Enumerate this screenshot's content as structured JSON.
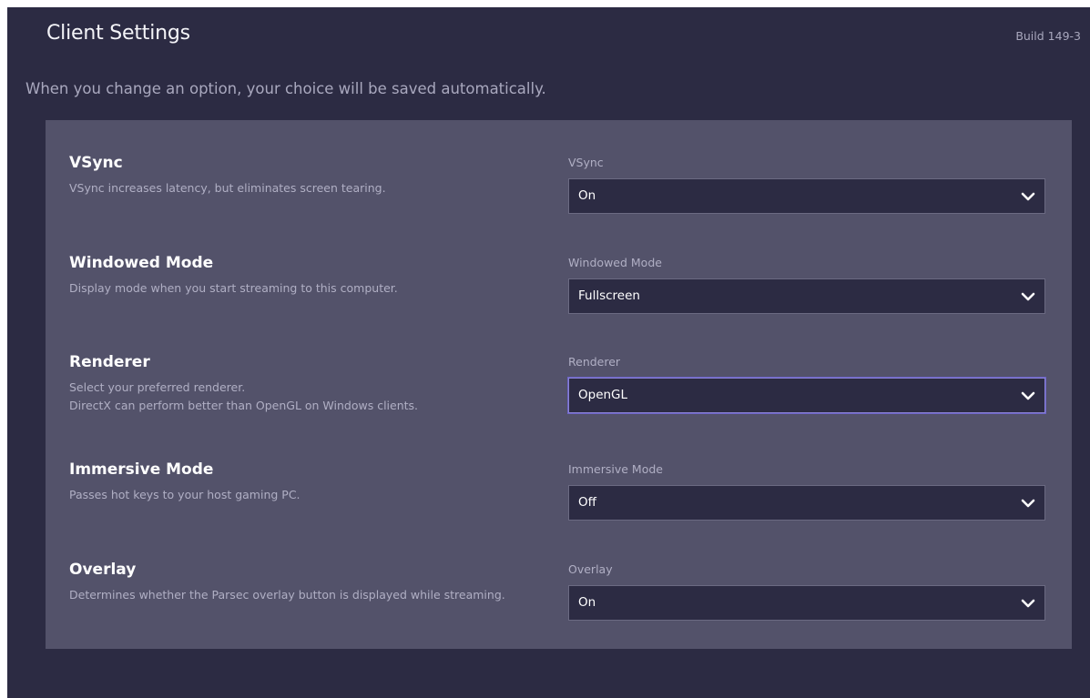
{
  "header": {
    "title": "Client Settings",
    "build": "Build 149-3",
    "subtitle": "When you change an option, your choice will be saved automatically."
  },
  "settings": [
    {
      "title": "VSync",
      "desc": "VSync increases latency, but eliminates screen tearing.",
      "field_label": "VSync",
      "value": "On"
    },
    {
      "title": "Windowed Mode",
      "desc": "Display mode when you start streaming to this computer.",
      "field_label": "Windowed Mode",
      "value": "Fullscreen"
    },
    {
      "title": "Renderer",
      "desc": "Select your preferred renderer.\nDirectX can perform better than OpenGL on Windows clients.",
      "field_label": "Renderer",
      "value": "OpenGL"
    },
    {
      "title": "Immersive Mode",
      "desc": "Passes hot keys to your host gaming PC.",
      "field_label": "Immersive Mode",
      "value": "Off"
    },
    {
      "title": "Overlay",
      "desc": "Determines whether the Parsec overlay button is displayed while streaming.",
      "field_label": "Overlay",
      "value": "On"
    }
  ],
  "colors": {
    "background": "#2c2b43",
    "panel": "#53526a",
    "select_bg": "#2c2b43",
    "focus_border": "#8b84d6"
  }
}
